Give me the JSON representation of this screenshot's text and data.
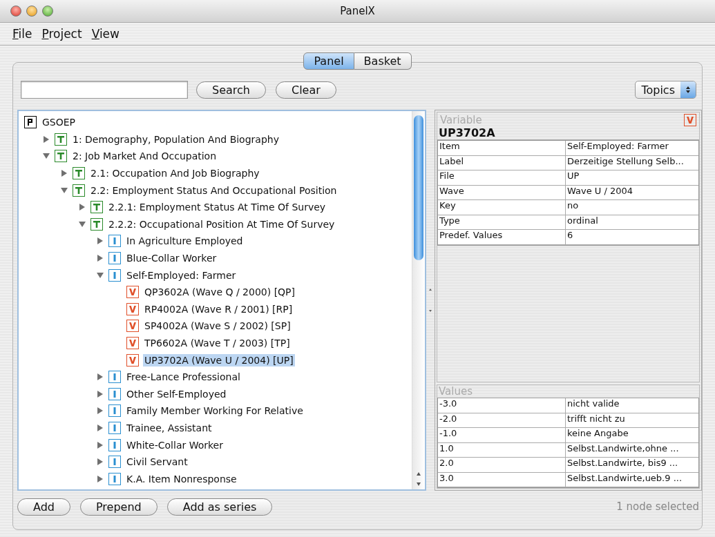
{
  "window": {
    "title": "PanelX"
  },
  "menu": [
    {
      "mnemonic": "F",
      "rest": "ile"
    },
    {
      "mnemonic": "P",
      "rest": "roject"
    },
    {
      "mnemonic": "V",
      "rest": "iew"
    }
  ],
  "tabs": [
    {
      "label": "Panel",
      "selected": true
    },
    {
      "label": "Basket",
      "selected": false
    }
  ],
  "search_buttons": [
    "Search",
    "Clear"
  ],
  "view_select": {
    "value": "Topics"
  },
  "tree": [
    {
      "kind": "P",
      "label": "GSOEP",
      "selected": false,
      "children": [
        {
          "kind": "T",
          "label": "1: Demography, Population And Biography",
          "expanded": false,
          "selected": false
        },
        {
          "kind": "T",
          "label": "2: Job Market And Occupation",
          "expanded": true,
          "selected": false,
          "children": [
            {
              "kind": "T",
              "label": "2.1: Occupation And Job Biography",
              "expanded": false,
              "selected": false
            },
            {
              "kind": "T",
              "label": "2.2: Employment Status And Occupational Position",
              "expanded": true,
              "selected": false,
              "children": [
                {
                  "kind": "T",
                  "label": "2.2.1: Employment Status At Time Of Survey",
                  "expanded": false,
                  "selected": false
                },
                {
                  "kind": "T",
                  "label": "2.2.2: Occupational Position At Time Of Survey",
                  "expanded": true,
                  "selected": false,
                  "children": [
                    {
                      "kind": "I",
                      "label": "In Agriculture Employed",
                      "expanded": false,
                      "selected": false
                    },
                    {
                      "kind": "I",
                      "label": "Blue-Collar Worker",
                      "expanded": false,
                      "selected": false
                    },
                    {
                      "kind": "I",
                      "label": "Self-Employed: Farmer",
                      "expanded": true,
                      "selected": false,
                      "children": [
                        {
                          "kind": "V",
                          "label": "QP3602A (Wave Q / 2000) [QP]",
                          "selected": false
                        },
                        {
                          "kind": "V",
                          "label": "RP4002A (Wave R / 2001) [RP]",
                          "selected": false
                        },
                        {
                          "kind": "V",
                          "label": "SP4002A (Wave S / 2002) [SP]",
                          "selected": false
                        },
                        {
                          "kind": "V",
                          "label": "TP6602A (Wave T / 2003) [TP]",
                          "selected": false
                        },
                        {
                          "kind": "V",
                          "label": "UP3702A (Wave U / 2004) [UP]",
                          "selected": true
                        }
                      ]
                    },
                    {
                      "kind": "I",
                      "label": "Free-Lance Professional",
                      "expanded": false,
                      "selected": false
                    },
                    {
                      "kind": "I",
                      "label": "Other Self-Employed",
                      "expanded": false,
                      "selected": false
                    },
                    {
                      "kind": "I",
                      "label": "Family Member Working For Relative",
                      "expanded": false,
                      "selected": false
                    },
                    {
                      "kind": "I",
                      "label": "Trainee, Assistant",
                      "expanded": false,
                      "selected": false
                    },
                    {
                      "kind": "I",
                      "label": "White-Collar Worker",
                      "expanded": false,
                      "selected": false
                    },
                    {
                      "kind": "I",
                      "label": "Civil Servant",
                      "expanded": false,
                      "selected": false
                    },
                    {
                      "kind": "I",
                      "label": "K.A. Item Nonresponse",
                      "expanded": false,
                      "selected": false
                    }
                  ]
                }
              ]
            }
          ]
        }
      ]
    }
  ],
  "details": {
    "heading": "Variable",
    "kind": "V",
    "name": "UP3702A",
    "rows": [
      [
        "Item",
        "Self-Employed: Farmer"
      ],
      [
        "Label",
        "Derzeitige Stellung Selb..."
      ],
      [
        "File",
        "UP"
      ],
      [
        "Wave",
        "Wave U / 2004"
      ],
      [
        "Key",
        "no"
      ],
      [
        "Type",
        "ordinal"
      ],
      [
        "Predef. Values",
        "6"
      ]
    ]
  },
  "values": {
    "heading": "Values",
    "rows": [
      [
        "-3.0",
        "nicht valide"
      ],
      [
        "-2.0",
        "trifft nicht zu"
      ],
      [
        "-1.0",
        "keine Angabe"
      ],
      [
        "1.0",
        "Selbst.Landwirte,ohne ..."
      ],
      [
        "2.0",
        "Selbst.Landwirte, bis9 ..."
      ],
      [
        "3.0",
        "Selbst.Landwirte,ueb.9 ..."
      ]
    ]
  },
  "bottom_buttons": [
    "Add",
    "Prepend",
    "Add as series"
  ],
  "status": "1 node selected"
}
